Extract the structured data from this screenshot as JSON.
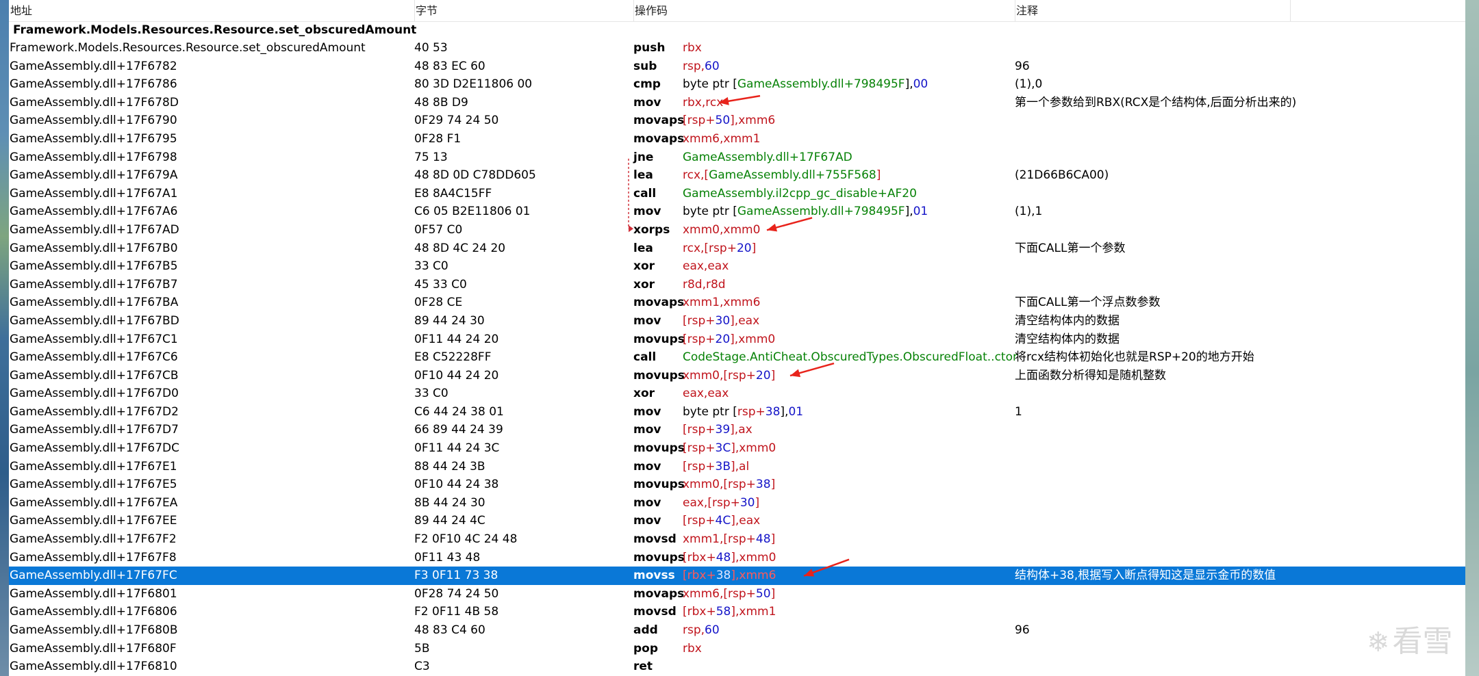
{
  "columns": {
    "address": "地址",
    "bytes": "字节",
    "opcode": "操作码",
    "comment": "注释"
  },
  "function_name": "Framework.Models.Resources.Resource.set_obscuredAmount",
  "rows": [
    {
      "addr": "Framework.Models.Resources.Resource.set_obscuredAmount",
      "bytes": "40 53",
      "mnem": "push",
      "ops": [
        {
          "t": "rbx",
          "c": "reg"
        }
      ],
      "comment": ""
    },
    {
      "addr": "GameAssembly.dll+17F6782",
      "bytes": "48 83 EC 60",
      "mnem": "sub",
      "ops": [
        {
          "t": "rsp",
          "c": "reg"
        },
        {
          "t": ",",
          "c": "reg"
        },
        {
          "t": "60",
          "c": "imm"
        }
      ],
      "comment": "96"
    },
    {
      "addr": "GameAssembly.dll+17F6786",
      "bytes": "80 3D D2E11806 00",
      "mnem": "cmp",
      "ops": [
        {
          "t": "byte ptr [",
          "c": "plain"
        },
        {
          "t": "GameAssembly.dll+798495F",
          "c": "sym"
        },
        {
          "t": "],",
          "c": "plain"
        },
        {
          "t": "00",
          "c": "imm"
        }
      ],
      "comment": "(1),0"
    },
    {
      "addr": "GameAssembly.dll+17F678D",
      "bytes": "48 8B D9",
      "mnem": "mov",
      "ops": [
        {
          "t": "rbx,rcx",
          "c": "reg"
        }
      ],
      "comment": "第一个参数给到RBX(RCX是个结构体,后面分析出来的)"
    },
    {
      "addr": "GameAssembly.dll+17F6790",
      "bytes": "0F29 74 24 50",
      "mnem": "movaps",
      "ops": [
        {
          "t": "[rsp+",
          "c": "reg"
        },
        {
          "t": "50",
          "c": "imm"
        },
        {
          "t": "],xmm6",
          "c": "reg"
        }
      ],
      "comment": ""
    },
    {
      "addr": "GameAssembly.dll+17F6795",
      "bytes": "0F28 F1",
      "mnem": "movaps",
      "ops": [
        {
          "t": "xmm6,xmm1",
          "c": "reg"
        }
      ],
      "comment": ""
    },
    {
      "addr": "GameAssembly.dll+17F6798",
      "bytes": "75 13",
      "mnem": "jne",
      "ops": [
        {
          "t": "GameAssembly.dll+17F67AD",
          "c": "sym"
        }
      ],
      "comment": ""
    },
    {
      "addr": "GameAssembly.dll+17F679A",
      "bytes": "48 8D 0D C78DD605",
      "mnem": "lea",
      "ops": [
        {
          "t": "rcx,[",
          "c": "reg"
        },
        {
          "t": "GameAssembly.dll+755F568",
          "c": "sym"
        },
        {
          "t": "]",
          "c": "reg"
        }
      ],
      "comment": "(21D66B6CA00)"
    },
    {
      "addr": "GameAssembly.dll+17F67A1",
      "bytes": "E8 8A4C15FF",
      "mnem": "call",
      "ops": [
        {
          "t": "GameAssembly.il2cpp_gc_disable+AF20",
          "c": "sym"
        }
      ],
      "comment": ""
    },
    {
      "addr": "GameAssembly.dll+17F67A6",
      "bytes": "C6 05 B2E11806 01",
      "mnem": "mov",
      "ops": [
        {
          "t": "byte ptr [",
          "c": "plain"
        },
        {
          "t": "GameAssembly.dll+798495F",
          "c": "sym"
        },
        {
          "t": "],",
          "c": "plain"
        },
        {
          "t": "01",
          "c": "imm"
        }
      ],
      "comment": "(1),1"
    },
    {
      "addr": "GameAssembly.dll+17F67AD",
      "bytes": "0F57 C0",
      "mnem": "xorps",
      "ops": [
        {
          "t": "xmm0,xmm0",
          "c": "reg"
        }
      ],
      "comment": ""
    },
    {
      "addr": "GameAssembly.dll+17F67B0",
      "bytes": "48 8D 4C 24 20",
      "mnem": "lea",
      "ops": [
        {
          "t": "rcx,[rsp+",
          "c": "reg"
        },
        {
          "t": "20",
          "c": "imm"
        },
        {
          "t": "]",
          "c": "reg"
        }
      ],
      "comment": "下面CALL第一个参数"
    },
    {
      "addr": "GameAssembly.dll+17F67B5",
      "bytes": "33 C0",
      "mnem": "xor",
      "ops": [
        {
          "t": "eax,eax",
          "c": "reg"
        }
      ],
      "comment": ""
    },
    {
      "addr": "GameAssembly.dll+17F67B7",
      "bytes": "45 33 C0",
      "mnem": "xor",
      "ops": [
        {
          "t": "r8d,r8d",
          "c": "reg"
        }
      ],
      "comment": ""
    },
    {
      "addr": "GameAssembly.dll+17F67BA",
      "bytes": "0F28 CE",
      "mnem": "movaps",
      "ops": [
        {
          "t": "xmm1,xmm6",
          "c": "reg"
        }
      ],
      "comment": "下面CALL第一个浮点数参数"
    },
    {
      "addr": "GameAssembly.dll+17F67BD",
      "bytes": "89 44 24 30",
      "mnem": "mov",
      "ops": [
        {
          "t": "[rsp+",
          "c": "reg"
        },
        {
          "t": "30",
          "c": "imm"
        },
        {
          "t": "],eax",
          "c": "reg"
        }
      ],
      "comment": "清空结构体内的数据"
    },
    {
      "addr": "GameAssembly.dll+17F67C1",
      "bytes": "0F11 44 24 20",
      "mnem": "movups",
      "ops": [
        {
          "t": "[rsp+",
          "c": "reg"
        },
        {
          "t": "20",
          "c": "imm"
        },
        {
          "t": "],xmm0",
          "c": "reg"
        }
      ],
      "comment": "清空结构体内的数据"
    },
    {
      "addr": "GameAssembly.dll+17F67C6",
      "bytes": "E8 C52228FF",
      "mnem": "call",
      "ops": [
        {
          "t": "CodeStage.AntiCheat.ObscuredTypes.ObscuredFloat..ctor",
          "c": "sym"
        }
      ],
      "comment": "将rcx结构体初始化也就是RSP+20的地方开始"
    },
    {
      "addr": "GameAssembly.dll+17F67CB",
      "bytes": "0F10 44 24 20",
      "mnem": "movups",
      "ops": [
        {
          "t": "xmm0,[rsp+",
          "c": "reg"
        },
        {
          "t": "20",
          "c": "imm"
        },
        {
          "t": "]",
          "c": "reg"
        }
      ],
      "comment": "上面函数分析得知是随机整数"
    },
    {
      "addr": "GameAssembly.dll+17F67D0",
      "bytes": "33 C0",
      "mnem": "xor",
      "ops": [
        {
          "t": "eax,eax",
          "c": "reg"
        }
      ],
      "comment": ""
    },
    {
      "addr": "GameAssembly.dll+17F67D2",
      "bytes": "C6 44 24 38 01",
      "mnem": "mov",
      "ops": [
        {
          "t": "byte ptr [",
          "c": "plain"
        },
        {
          "t": "rsp+",
          "c": "reg"
        },
        {
          "t": "38",
          "c": "imm"
        },
        {
          "t": "],",
          "c": "plain"
        },
        {
          "t": "01",
          "c": "imm"
        }
      ],
      "comment": "1"
    },
    {
      "addr": "GameAssembly.dll+17F67D7",
      "bytes": "66 89 44 24 39",
      "mnem": "mov",
      "ops": [
        {
          "t": "[rsp+",
          "c": "reg"
        },
        {
          "t": "39",
          "c": "imm"
        },
        {
          "t": "],ax",
          "c": "reg"
        }
      ],
      "comment": ""
    },
    {
      "addr": "GameAssembly.dll+17F67DC",
      "bytes": "0F11 44 24 3C",
      "mnem": "movups",
      "ops": [
        {
          "t": "[rsp+",
          "c": "reg"
        },
        {
          "t": "3C",
          "c": "imm"
        },
        {
          "t": "],xmm0",
          "c": "reg"
        }
      ],
      "comment": ""
    },
    {
      "addr": "GameAssembly.dll+17F67E1",
      "bytes": "88 44 24 3B",
      "mnem": "mov",
      "ops": [
        {
          "t": "[rsp+",
          "c": "reg"
        },
        {
          "t": "3B",
          "c": "imm"
        },
        {
          "t": "],al",
          "c": "reg"
        }
      ],
      "comment": ""
    },
    {
      "addr": "GameAssembly.dll+17F67E5",
      "bytes": "0F10 44 24 38",
      "mnem": "movups",
      "ops": [
        {
          "t": "xmm0,[rsp+",
          "c": "reg"
        },
        {
          "t": "38",
          "c": "imm"
        },
        {
          "t": "]",
          "c": "reg"
        }
      ],
      "comment": ""
    },
    {
      "addr": "GameAssembly.dll+17F67EA",
      "bytes": "8B 44 24 30",
      "mnem": "mov",
      "ops": [
        {
          "t": "eax,[rsp+",
          "c": "reg"
        },
        {
          "t": "30",
          "c": "imm"
        },
        {
          "t": "]",
          "c": "reg"
        }
      ],
      "comment": ""
    },
    {
      "addr": "GameAssembly.dll+17F67EE",
      "bytes": "89 44 24 4C",
      "mnem": "mov",
      "ops": [
        {
          "t": "[rsp+",
          "c": "reg"
        },
        {
          "t": "4C",
          "c": "imm"
        },
        {
          "t": "],eax",
          "c": "reg"
        }
      ],
      "comment": ""
    },
    {
      "addr": "GameAssembly.dll+17F67F2",
      "bytes": "F2 0F10 4C 24 48",
      "mnem": "movsd",
      "ops": [
        {
          "t": "xmm1,[rsp+",
          "c": "reg"
        },
        {
          "t": "48",
          "c": "imm"
        },
        {
          "t": "]",
          "c": "reg"
        }
      ],
      "comment": ""
    },
    {
      "addr": "GameAssembly.dll+17F67F8",
      "bytes": "0F11 43 48",
      "mnem": "movups",
      "ops": [
        {
          "t": "[rbx+",
          "c": "reg"
        },
        {
          "t": "48",
          "c": "imm"
        },
        {
          "t": "],xmm0",
          "c": "reg"
        }
      ],
      "comment": ""
    },
    {
      "addr": "GameAssembly.dll+17F67FC",
      "bytes": "F3 0F11 73 38",
      "mnem": "movss",
      "ops": [
        {
          "t": "[rbx+",
          "c": "reg"
        },
        {
          "t": "38",
          "c": "imm"
        },
        {
          "t": "],xmm6",
          "c": "reg"
        }
      ],
      "comment": "结构体+38,根据写入断点得知这是显示金币的数值",
      "selected": true
    },
    {
      "addr": "GameAssembly.dll+17F6801",
      "bytes": "0F28 74 24 50",
      "mnem": "movaps",
      "ops": [
        {
          "t": "xmm6,[rsp+",
          "c": "reg"
        },
        {
          "t": "50",
          "c": "imm"
        },
        {
          "t": "]",
          "c": "reg"
        }
      ],
      "comment": ""
    },
    {
      "addr": "GameAssembly.dll+17F6806",
      "bytes": "F2 0F11 4B 58",
      "mnem": "movsd",
      "ops": [
        {
          "t": "[rbx+",
          "c": "reg"
        },
        {
          "t": "58",
          "c": "imm"
        },
        {
          "t": "],xmm1",
          "c": "reg"
        }
      ],
      "comment": ""
    },
    {
      "addr": "GameAssembly.dll+17F680B",
      "bytes": "48 83 C4 60",
      "mnem": "add",
      "ops": [
        {
          "t": "rsp",
          "c": "reg"
        },
        {
          "t": ",",
          "c": "reg"
        },
        {
          "t": "60",
          "c": "imm"
        }
      ],
      "comment": "96"
    },
    {
      "addr": "GameAssembly.dll+17F680F",
      "bytes": "5B",
      "mnem": "pop",
      "ops": [
        {
          "t": "rbx",
          "c": "reg"
        }
      ],
      "comment": ""
    },
    {
      "addr": "GameAssembly.dll+17F6810",
      "bytes": "C3",
      "mnem": "ret",
      "ops": [],
      "comment": ""
    }
  ],
  "annotation_arrows": [
    {
      "row": 3
    },
    {
      "row": 10
    },
    {
      "row": 18
    },
    {
      "row": 29
    }
  ],
  "jump_line": {
    "from_row": 6,
    "to_row": 10
  },
  "watermark": {
    "icon": "snowflake-icon",
    "text": "看雪"
  },
  "colors": {
    "register": "#c0141c",
    "immediate": "#1414c8",
    "symbol": "#078207",
    "selection": "#0a78d7",
    "arrow": "#e8231b"
  }
}
